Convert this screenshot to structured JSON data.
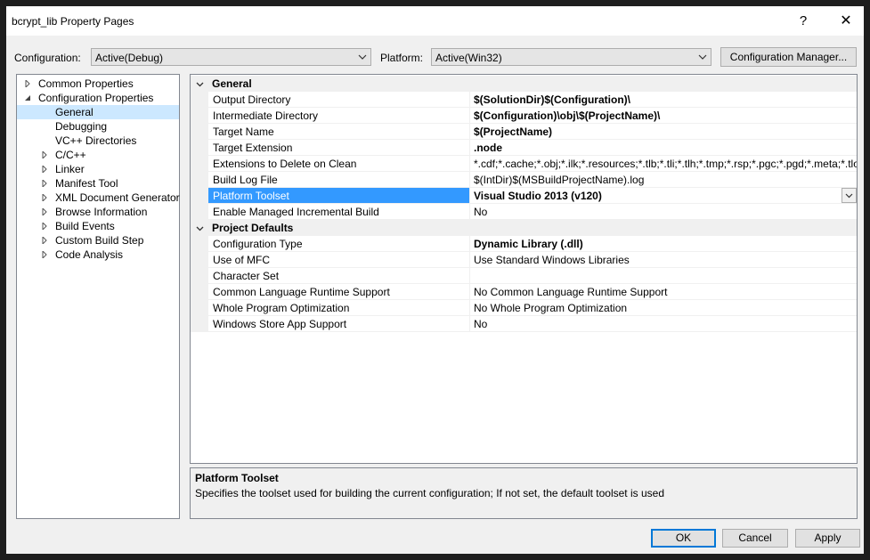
{
  "window": {
    "title": "bcrypt_lib Property Pages",
    "help": "?",
    "close": "✕"
  },
  "config": {
    "configuration_label": "Configuration:",
    "configuration_value": "Active(Debug)",
    "platform_label": "Platform:",
    "platform_value": "Active(Win32)",
    "manager_button": "Configuration Manager..."
  },
  "tree": {
    "items": [
      {
        "label": "Common Properties",
        "expander": "collapsed"
      },
      {
        "label": "Configuration Properties",
        "expander": "expanded"
      },
      {
        "label": "General",
        "expander": "none",
        "selected": true
      },
      {
        "label": "Debugging",
        "expander": "none"
      },
      {
        "label": "VC++ Directories",
        "expander": "none"
      },
      {
        "label": "C/C++",
        "expander": "collapsed"
      },
      {
        "label": "Linker",
        "expander": "collapsed"
      },
      {
        "label": "Manifest Tool",
        "expander": "collapsed"
      },
      {
        "label": "XML Document Generator",
        "expander": "collapsed"
      },
      {
        "label": "Browse Information",
        "expander": "collapsed"
      },
      {
        "label": "Build Events",
        "expander": "collapsed"
      },
      {
        "label": "Custom Build Step",
        "expander": "collapsed"
      },
      {
        "label": "Code Analysis",
        "expander": "collapsed"
      }
    ]
  },
  "grid": {
    "categories": [
      {
        "name": "General",
        "rows": [
          {
            "name": "Output Directory",
            "value": "$(SolutionDir)$(Configuration)\\",
            "bold": true
          },
          {
            "name": "Intermediate Directory",
            "value": "$(Configuration)\\obj\\$(ProjectName)\\",
            "bold": true
          },
          {
            "name": "Target Name",
            "value": "$(ProjectName)",
            "bold": true
          },
          {
            "name": "Target Extension",
            "value": ".node",
            "bold": true
          },
          {
            "name": "Extensions to Delete on Clean",
            "value": "*.cdf;*.cache;*.obj;*.ilk;*.resources;*.tlb;*.tli;*.tlh;*.tmp;*.rsp;*.pgc;*.pgd;*.meta;*.tlog;*.man",
            "bold": false
          },
          {
            "name": "Build Log File",
            "value": "$(IntDir)$(MSBuildProjectName).log",
            "bold": false
          },
          {
            "name": "Platform Toolset",
            "value": "Visual Studio 2013 (v120)",
            "bold": true,
            "selected": true
          },
          {
            "name": "Enable Managed Incremental Build",
            "value": "No",
            "bold": false
          }
        ]
      },
      {
        "name": "Project Defaults",
        "rows": [
          {
            "name": "Configuration Type",
            "value": "Dynamic Library (.dll)",
            "bold": true
          },
          {
            "name": "Use of MFC",
            "value": "Use Standard Windows Libraries",
            "bold": false
          },
          {
            "name": "Character Set",
            "value": "",
            "bold": false
          },
          {
            "name": "Common Language Runtime Support",
            "value": "No Common Language Runtime Support",
            "bold": false
          },
          {
            "name": "Whole Program Optimization",
            "value": "No Whole Program Optimization",
            "bold": false
          },
          {
            "name": "Windows Store App Support",
            "value": "No",
            "bold": false
          }
        ]
      }
    ]
  },
  "description": {
    "title": "Platform Toolset",
    "text": "Specifies the toolset used for building the current configuration; If not set, the default toolset is used"
  },
  "buttons": {
    "ok": "OK",
    "cancel": "Cancel",
    "apply": "Apply"
  },
  "colors": {
    "selection": "#3399ff",
    "tree_selection": "#cce8ff",
    "dialog_bg": "#f0f0f0",
    "accent": "#0078d7"
  }
}
